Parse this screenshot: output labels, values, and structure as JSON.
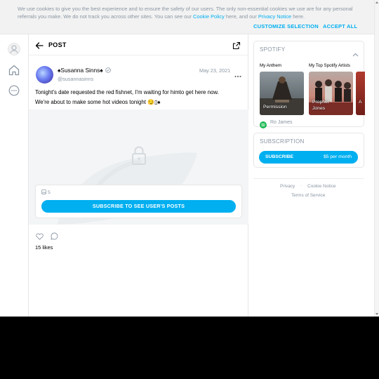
{
  "cookie_banner": {
    "text_before_policy": "We use cookies to give you the best experience and to ensure the safety of our users. The only non-essential cookies we use are for any personal referrals you make. We do not track you across other sites. You can see our ",
    "policy_link": "Cookie Policy",
    "text_middle": " here, and our ",
    "privacy_link": "Privacy Notice",
    "text_end": " here.",
    "customize_label": "CUSTOMIZE SELECTION",
    "accept_label": "ACCEPT ALL"
  },
  "post_header": {
    "title": "POST"
  },
  "post": {
    "user_name": "♠Susanna Sinns♠",
    "handle": "@susannasinns",
    "date": "May 23, 2021",
    "text_line1": "Tonight's date requested the red fishnet, I'm waiting for himto get here now.",
    "text_line2": "We're about to make some hot videos tonight 😏▯♠",
    "media_count": "5",
    "subscribe_button": "SUBSCRIBE TO SEE USER'S POSTS",
    "likes": "15 likes"
  },
  "spotify": {
    "heading": "SPOTIFY",
    "anthem_heading": "My Anthem",
    "artists_heading": "My Top Spotify Artists",
    "tiles": [
      {
        "label": "Permission"
      },
      {
        "label_line1": "Prophet",
        "label_line2": "Jones"
      },
      {
        "label": "A"
      }
    ],
    "artist_name": "Ro James"
  },
  "subscription": {
    "heading": "SUBSCRIPTION",
    "button_label": "SUBSCRIBE",
    "price": "$5 per month"
  },
  "footer": {
    "privacy": "Privacy",
    "separator": "·",
    "cookie_notice": "Cookie Notice",
    "terms": "Terms of Service"
  },
  "colors": {
    "accent": "#00aff0",
    "muted_text": "#8a96a3",
    "spotify_green": "#1db954"
  }
}
